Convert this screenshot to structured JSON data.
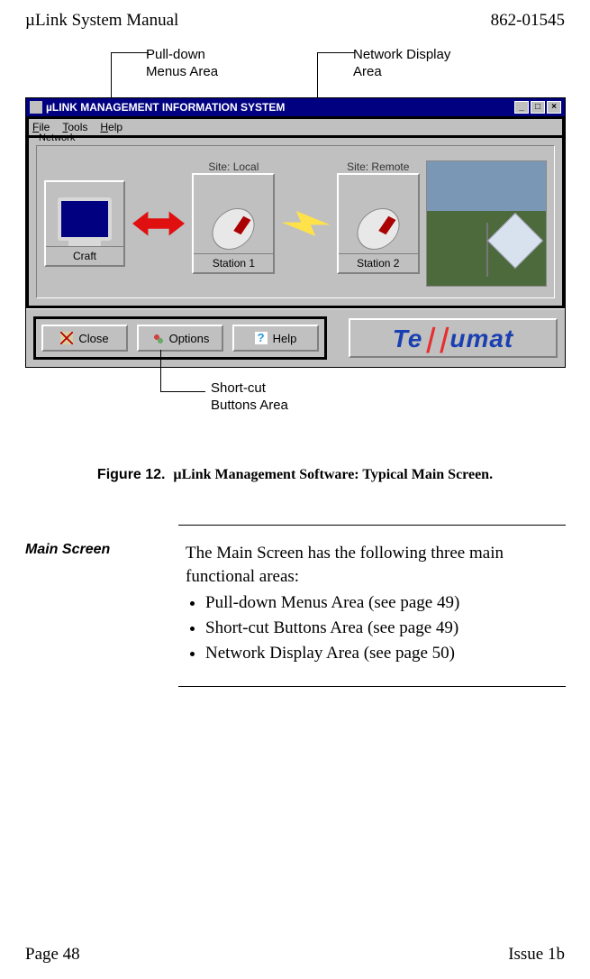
{
  "header": {
    "left": "µLink System Manual",
    "right": "862-01545"
  },
  "annotations": {
    "pulldown": "Pull-down\nMenus Area",
    "network": "Network Display\nArea",
    "shortcut": "Short-cut\nButtons Area"
  },
  "window": {
    "title": "µLINK MANAGEMENT INFORMATION SYSTEM",
    "menu": [
      "File",
      "Tools",
      "Help"
    ],
    "group_label": "Network",
    "craft_caption": "Craft",
    "site_local": "Site: Local",
    "station1_caption": "Station 1",
    "site_remote": "Site: Remote",
    "station2_caption": "Station 2",
    "buttons": {
      "close": "Close",
      "options": "Options",
      "help": "Help"
    },
    "brand_left": "Te",
    "brand_slash": "∣∣",
    "brand_right": "umat"
  },
  "figure": {
    "number": "Figure 12.",
    "title": "µLink Management Software:  Typical Main Screen."
  },
  "section": {
    "sidehead": "Main Screen",
    "intro": "The Main Screen has the following three main functional areas:",
    "bullets": [
      "Pull-down Menus Area (see page 49)",
      "Short-cut Buttons Area (see page 49)",
      "Network Display Area (see page 50)"
    ]
  },
  "footer": {
    "left": "Page 48",
    "right": "Issue 1b"
  }
}
